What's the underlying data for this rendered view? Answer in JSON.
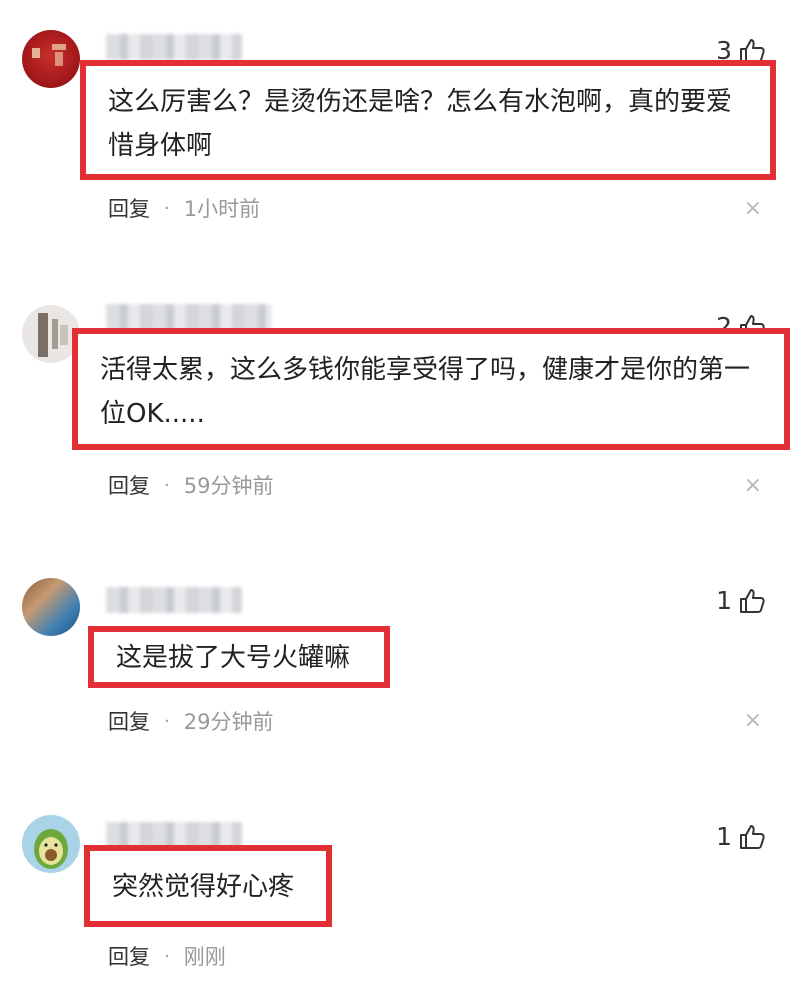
{
  "comments": [
    {
      "likes": "3",
      "content": "这么厉害么？是烫伤还是啥？怎么有水泡啊，真的要爱惜身体啊",
      "reply_label": "回复",
      "separator": "·",
      "time": "1小时前",
      "close_glyph": "×"
    },
    {
      "likes": "2",
      "content": "活得太累，这么多钱你能享受得了吗，健康才是你的第一位OK.....",
      "reply_label": "回复",
      "separator": "·",
      "time": "59分钟前",
      "close_glyph": "×"
    },
    {
      "likes": "1",
      "content": "这是拔了大号火罐嘛",
      "reply_label": "回复",
      "separator": "·",
      "time": "29分钟前",
      "close_glyph": "×"
    },
    {
      "likes": "1",
      "content": "突然觉得好心疼",
      "reply_label": "回复",
      "separator": "·",
      "time": "刚刚",
      "close_glyph": "×"
    }
  ],
  "colors": {
    "highlight_border": "#e23034",
    "meta_time": "#999999"
  },
  "icons": {
    "like": "thumbs-up-icon",
    "close": "close-icon"
  }
}
